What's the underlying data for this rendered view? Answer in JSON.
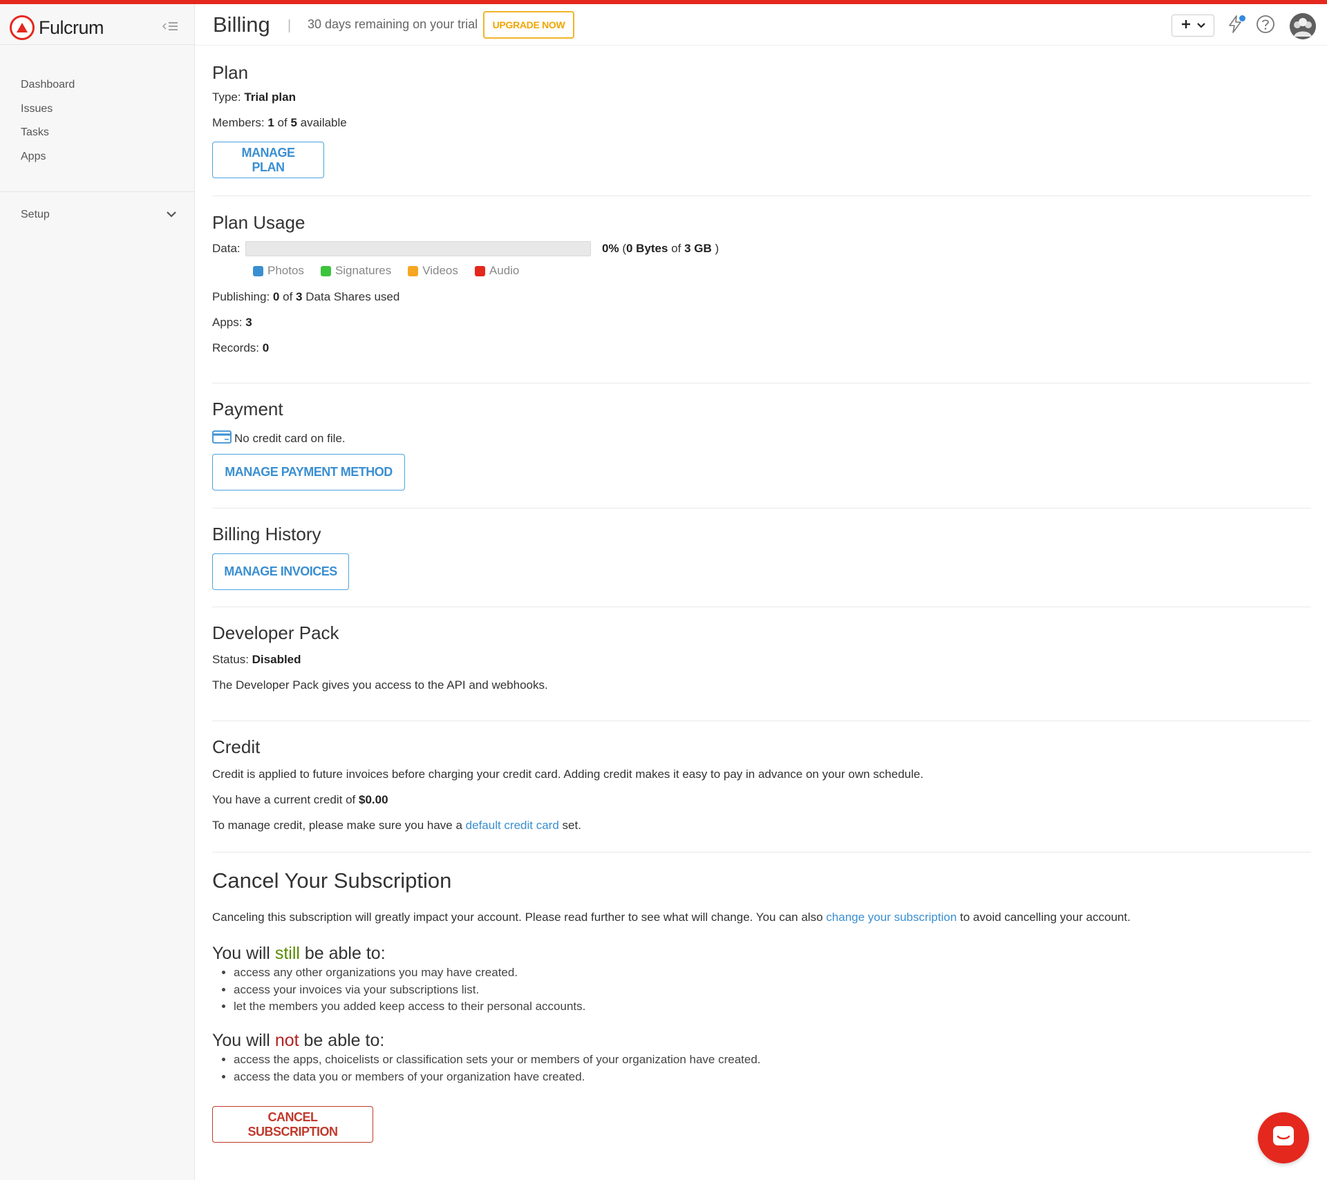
{
  "app": {
    "name": "Fulcrum"
  },
  "sidebar": {
    "items": [
      {
        "label": "Dashboard"
      },
      {
        "label": "Issues"
      },
      {
        "label": "Tasks"
      },
      {
        "label": "Apps"
      }
    ],
    "setup_label": "Setup"
  },
  "header": {
    "title": "Billing",
    "separator": "|",
    "trial_text": "30 days remaining on your trial",
    "upgrade_label": "UPGRADE NOW"
  },
  "plan": {
    "heading": "Plan",
    "type_label": "Type:",
    "type_value": "Trial plan",
    "members_label": "Members:",
    "members_used": "1",
    "members_of": "of",
    "members_total": "5",
    "members_suffix": "available",
    "manage_label": "MANAGE PLAN"
  },
  "usage": {
    "heading": "Plan Usage",
    "data_label": "Data:",
    "data_percent_value": 0,
    "data_percent": "0%",
    "data_open": "(",
    "data_used": "0 Bytes",
    "data_of": "of",
    "data_total": "3 GB",
    "data_close": ")",
    "legend": [
      {
        "label": "Photos",
        "color": "#3a8fd1"
      },
      {
        "label": "Signatures",
        "color": "#3cc43c"
      },
      {
        "label": "Videos",
        "color": "#f5a623"
      },
      {
        "label": "Audio",
        "color": "#e4281e"
      }
    ],
    "publishing_label": "Publishing:",
    "publishing_used": "0",
    "publishing_of": "of",
    "publishing_total": "3",
    "publishing_suffix": "Data Shares used",
    "apps_label": "Apps:",
    "apps_value": "3",
    "records_label": "Records:",
    "records_value": "0"
  },
  "payment": {
    "heading": "Payment",
    "no_card_text": "No credit card on file.",
    "manage_label": "MANAGE PAYMENT METHOD"
  },
  "billing_history": {
    "heading": "Billing History",
    "manage_label": "MANAGE INVOICES"
  },
  "developer_pack": {
    "heading": "Developer Pack",
    "status_label": "Status:",
    "status_value": "Disabled",
    "description": "The Developer Pack gives you access to the API and webhooks."
  },
  "credit": {
    "heading": "Credit",
    "description": "Credit is applied to future invoices before charging your credit card. Adding credit makes it easy to pay in advance on your own schedule.",
    "current_prefix": "You have a current credit of",
    "current_value": "$0.00",
    "manage_prefix": "To manage credit, please make sure you have a",
    "manage_link": "default credit card",
    "manage_suffix": "set."
  },
  "cancel": {
    "heading": "Cancel Your Subscription",
    "intro_prefix": "Canceling this subscription will greatly impact your account. Please read further to see what will change. You can also",
    "intro_link": "change your subscription",
    "intro_suffix": "to avoid cancelling your account.",
    "still_prefix": "You will",
    "still_word": "still",
    "still_suffix": "be able to:",
    "still_items": [
      "access any other organizations you may have created.",
      "access your invoices via your subscriptions list.",
      "let the members you added keep access to their personal accounts."
    ],
    "not_prefix": "You will",
    "not_word": "not",
    "not_suffix": "be able to:",
    "not_items": [
      "access the apps, choicelists or classification sets your or members of your organization have created.",
      "access the data you or members of your organization have created."
    ],
    "button_label": "CANCEL SUBSCRIPTION"
  },
  "colors": {
    "brand": "#e4281e",
    "link": "#3a8fd1",
    "upgrade": "#f0a500",
    "danger": "#c0392b",
    "still": "#5a8a00",
    "not": "#b22222"
  },
  "icons": {
    "logo": "fulcrum-logo-icon",
    "collapse": "collapse-sidebar-icon",
    "setup_toggle": "chevron-down-icon",
    "add": "plus-icon",
    "add_dropdown": "chevron-down-icon",
    "notifications": "lightning-icon",
    "help": "question-circle-icon",
    "avatar": "user-avatar-icon",
    "card": "credit-card-icon",
    "chat": "chat-icon"
  }
}
